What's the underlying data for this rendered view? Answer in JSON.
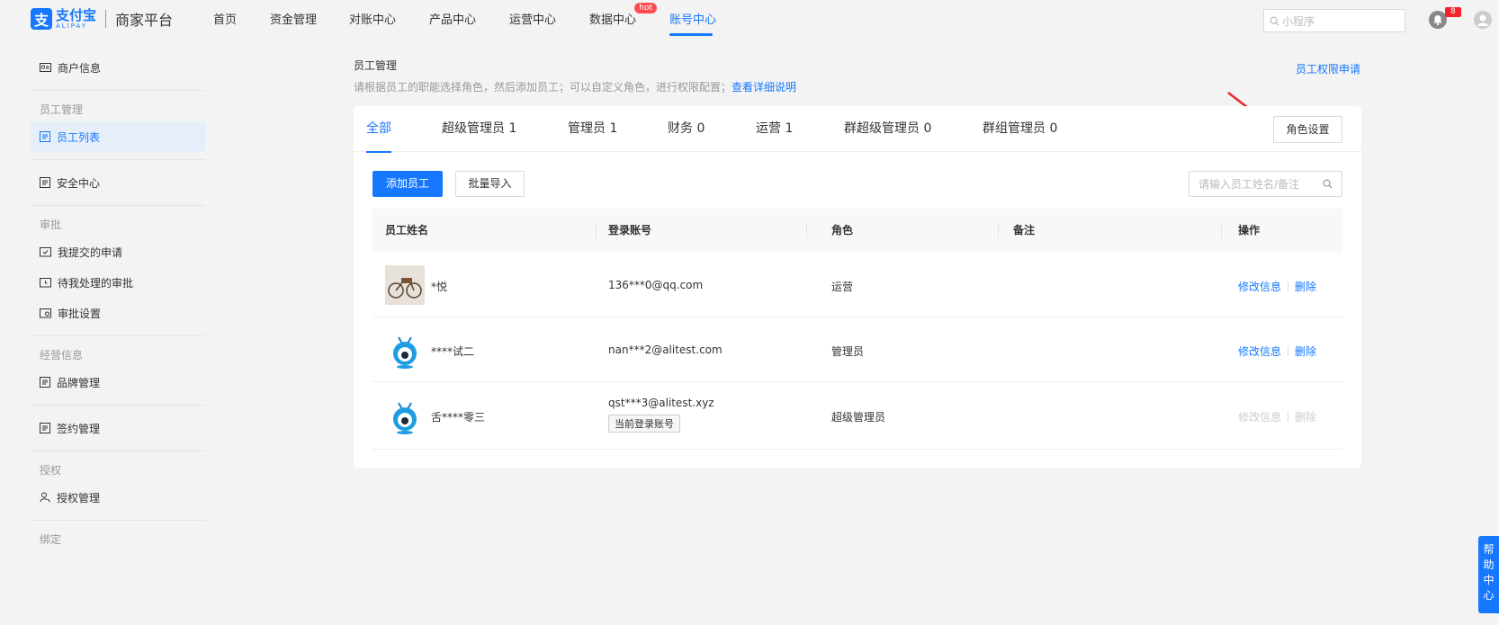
{
  "brand": {
    "logo_glyph": "支",
    "name_cn": "支付宝",
    "name_en": "ALIPAY",
    "platform": "商家平台",
    "accent": "#1677ff"
  },
  "nav": {
    "items": [
      {
        "label": "首页"
      },
      {
        "label": "资金管理"
      },
      {
        "label": "对账中心"
      },
      {
        "label": "产品中心"
      },
      {
        "label": "运营中心"
      },
      {
        "label": "数据中心",
        "badge": "hot"
      },
      {
        "label": "账号中心",
        "active": true
      }
    ]
  },
  "top_search": {
    "placeholder": "小程序"
  },
  "notifications": {
    "count": "8"
  },
  "sidebar": {
    "merchant_info": "商户信息",
    "group_staff": "员工管理",
    "staff_list": "员工列表",
    "security_center": "安全中心",
    "group_approval": "审批",
    "my_submitted": "我提交的申请",
    "pending_approval": "待我处理的审批",
    "approval_settings": "审批设置",
    "group_business": "经营信息",
    "brand_management": "品牌管理",
    "contract_management": "签约管理",
    "group_auth": "授权",
    "auth_management": "授权管理",
    "group_binding": "绑定"
  },
  "page": {
    "title": "员工管理",
    "description": "请根据员工的职能选择角色，然后添加员工；可以自定义角色，进行权限配置；",
    "detail_link": "查看详细说明",
    "permission_link": "员工权限申请"
  },
  "tabs": [
    {
      "label": "全部",
      "active": true
    },
    {
      "label": "超级管理员  1"
    },
    {
      "label": "管理员  1"
    },
    {
      "label": "财务  0"
    },
    {
      "label": "运营  1"
    },
    {
      "label": "群超级管理员  0"
    },
    {
      "label": "群组管理员  0"
    }
  ],
  "toolbar": {
    "role_settings": "角色设置",
    "add_employee": "添加员工",
    "batch_import": "批量导入",
    "search_placeholder": "请输入员工姓名/备注"
  },
  "table": {
    "headers": [
      "员工姓名",
      "登录账号",
      "角色",
      "备注",
      "操作"
    ],
    "rows": [
      {
        "avatar": "bicycle-photo",
        "name": "*悦",
        "account": "136***0@qq.com",
        "role": "运营",
        "note": "",
        "edit": "修改信息",
        "delete": "删除",
        "disabled": false
      },
      {
        "avatar": "ant-mascot",
        "name": "****试二",
        "account": "nan***2@alitest.com",
        "role": "管理员",
        "note": "",
        "edit": "修改信息",
        "delete": "删除",
        "disabled": false
      },
      {
        "avatar": "ant-mascot",
        "name": "舌****零三",
        "account": "qst***3@alitest.xyz",
        "account_tag": "当前登录账号",
        "role": "超级管理员",
        "note": "",
        "edit": "修改信息",
        "delete": "删除",
        "disabled": true
      }
    ]
  },
  "help": {
    "label": "帮助中心"
  }
}
